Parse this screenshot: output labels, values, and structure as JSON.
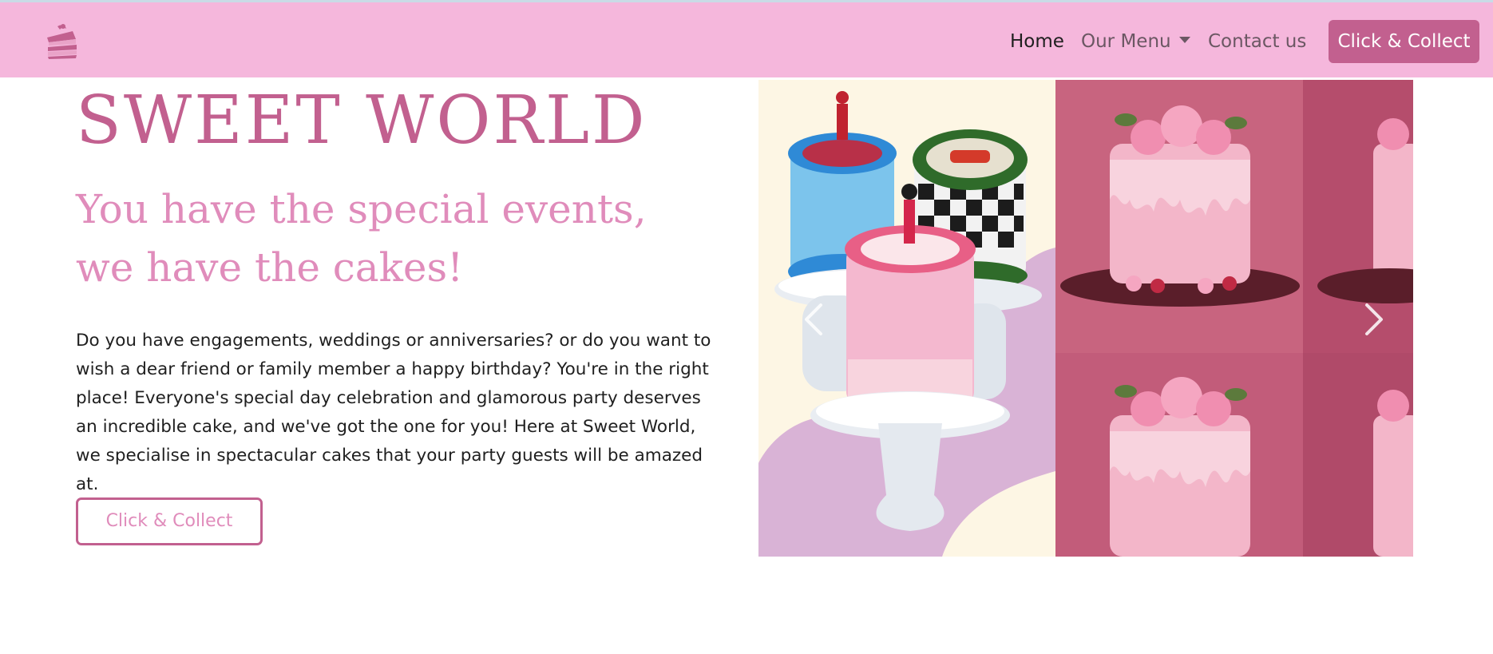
{
  "navbar": {
    "logo_icon": "cake-slice-icon",
    "links": [
      {
        "label": "Home",
        "active": true
      },
      {
        "label": "Our Menu",
        "has_dropdown": true
      },
      {
        "label": "Contact us"
      }
    ],
    "cta_label": "Click & Collect"
  },
  "hero": {
    "title": "SWEET WORLD",
    "subtitle": "You have the special events, we have the cakes!",
    "description": "Do you have engagements, weddings or anniversaries? or do you want to wish a dear friend or family member a happy birthday? You're in the right place! Everyone's special day celebration and glamorous party deserves an incredible cake, and we've got the one for you! Here at Sweet World, we specialise in spectacular cakes that your party guests will be amazed at.",
    "cta_label": "Click & Collect"
  },
  "carousel": {
    "prev_icon": "chevron-left-icon",
    "next_icon": "chevron-right-icon"
  },
  "colors": {
    "navbar_bg": "#f5b7dc",
    "brand": "#c2608f",
    "subtitle": "#e08cbb"
  }
}
